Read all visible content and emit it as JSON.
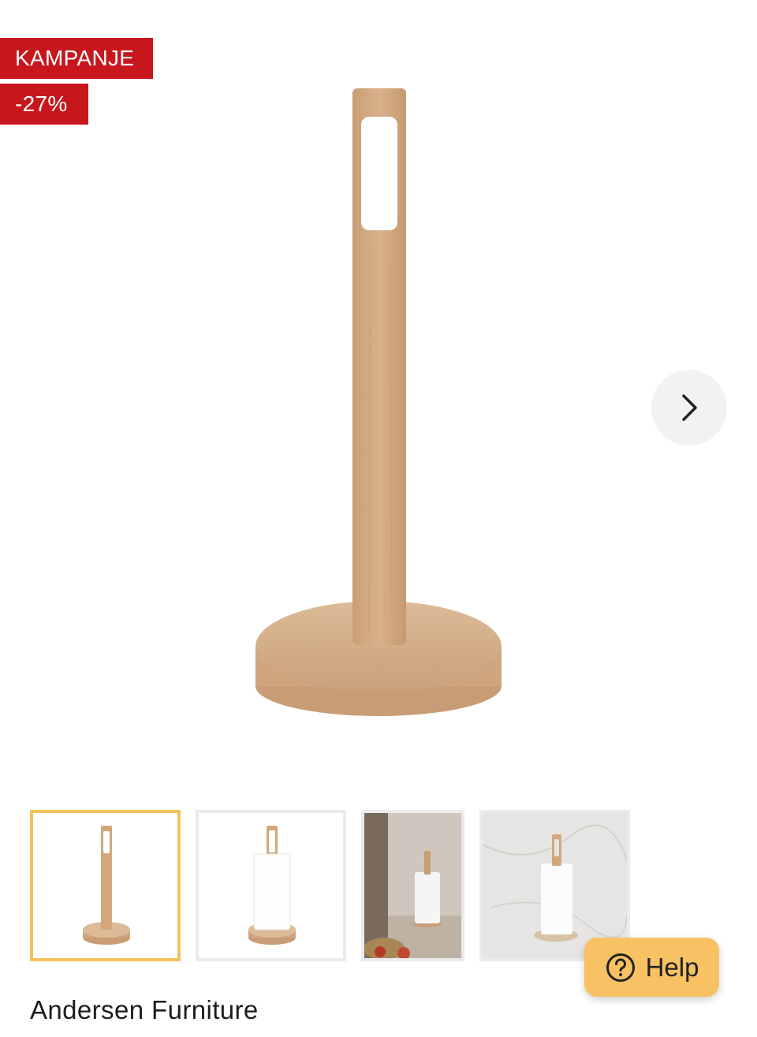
{
  "badges": {
    "campaign": "KAMPANJE",
    "discount": "-27%"
  },
  "gallery": {
    "main_image": "wooden-paper-towel-holder",
    "next_icon": "chevron-right-icon",
    "thumbnails": [
      {
        "image": "holder-plain",
        "selected": true
      },
      {
        "image": "holder-with-paper-roll",
        "selected": false
      },
      {
        "image": "holder-kitchen-scene",
        "selected": false
      },
      {
        "image": "holder-on-marble",
        "selected": false
      }
    ]
  },
  "help": {
    "label": "Help",
    "icon": "question-circle-icon"
  },
  "product": {
    "brand": "Andersen Furniture"
  },
  "colors": {
    "badge": "#c8161d",
    "selected_thumb": "#f2c15a",
    "help_button": "#f8c163"
  }
}
